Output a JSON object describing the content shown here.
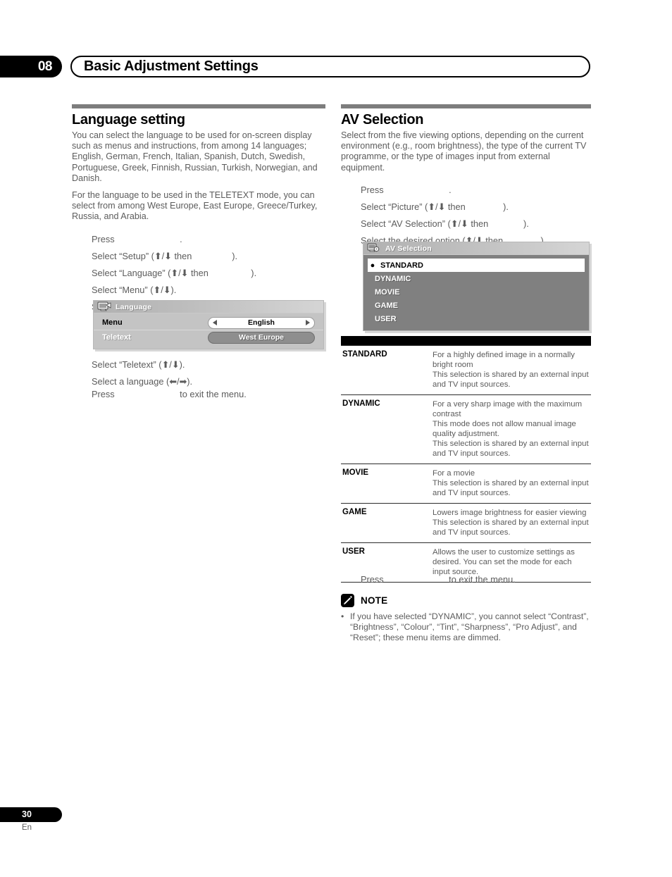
{
  "header": {
    "chapter_number": "08",
    "chapter_title": "Basic Adjustment Settings"
  },
  "left_column": {
    "section_title": "Language setting",
    "intro_paragraphs": [
      "You can select the language to be used for on-screen display such as menus and instructions, from among 14 languages; English, German, French, Italian, Spanish, Dutch, Swedish, Portuguese, Greek, Finnish, Russian, Turkish, Norwegian, and Danish.",
      "For the language to be used in the TELETEXT mode, you can select from among West Europe, East Europe, Greece/Turkey, Russia, and Arabia."
    ],
    "steps": [
      "Press                          .",
      "Select “Setup” (⬆/⬇ then                ).",
      "Select “Language” (⬆/⬇ then                 ).",
      "Select “Menu” (⬆/⬇).",
      "Select a language (⬅/➡)."
    ],
    "steps_after": [
      "Select “Teletext” (⬆/⬇).",
      "Select a language (⬅/➡)."
    ],
    "exit_line": "Press                          to exit the menu.",
    "osd": {
      "icon": "tv-monitor-icon",
      "title": "Language",
      "rows": [
        {
          "label": "Menu",
          "value": "English",
          "state": "selected",
          "arrows": true
        },
        {
          "label": "Teletext",
          "value": "West Europe",
          "state": "unselected",
          "arrows": false
        }
      ]
    }
  },
  "right_column": {
    "section_title": "AV Selection",
    "intro_paragraphs": [
      "Select from the five viewing options, depending on the current environment (e.g., room brightness), the type of the current TV programme, or the type of images input from external equipment."
    ],
    "steps": [
      "Press                          .",
      "Select “Picture” (⬆/⬇ then               ).",
      "Select “AV Selection” (⬆/⬇ then              ).",
      "Select the desired option (⬆/⬇ then               )."
    ],
    "exit_line": "Press                          to exit the menu.",
    "osd": {
      "icon": "tv-gear-icon",
      "title": "AV Selection",
      "items": [
        {
          "label": "STANDARD",
          "selected": true,
          "bullet": "●"
        },
        {
          "label": "DYNAMIC",
          "selected": false,
          "bullet": ""
        },
        {
          "label": "MOVIE",
          "selected": false,
          "bullet": ""
        },
        {
          "label": "GAME",
          "selected": false,
          "bullet": ""
        },
        {
          "label": "USER",
          "selected": false,
          "bullet": ""
        }
      ]
    },
    "description_table": {
      "header_label": "",
      "rows": [
        {
          "term": "STANDARD",
          "definition": "For a highly defined image in a normally bright room\nThis selection is shared by an external input and TV input sources."
        },
        {
          "term": "DYNAMIC",
          "definition": "For a very sharp image with the maximum contrast\nThis mode does not allow manual image quality adjustment.\nThis selection is shared by an external input and TV input sources."
        },
        {
          "term": "MOVIE",
          "definition": "For a movie\nThis selection is shared by an external input and TV input sources."
        },
        {
          "term": "GAME",
          "definition": "Lowers image brightness for easier viewing\nThis selection is shared by an external input and TV input sources."
        },
        {
          "term": "USER",
          "definition": "Allows the user to customize settings as desired. You can set the mode for each input source."
        }
      ]
    },
    "note": {
      "icon": "pencil-note-icon",
      "label": "NOTE",
      "items": [
        "If you have selected “DYNAMIC”, you cannot select “Contrast”, “Brightness”, “Colour”, “Tint”, “Sharpness”, “Pro Adjust”, and “Reset”; these menu items are dimmed."
      ]
    }
  },
  "footer": {
    "page_number": "30",
    "language_code": "En"
  },
  "colors": {
    "rule_gray": "#7d7d7d",
    "body_text": "#5c5c5c",
    "heading_black": "#000000",
    "osd_gray": "#c4c4c4",
    "osd_dark_gray": "#808080"
  }
}
